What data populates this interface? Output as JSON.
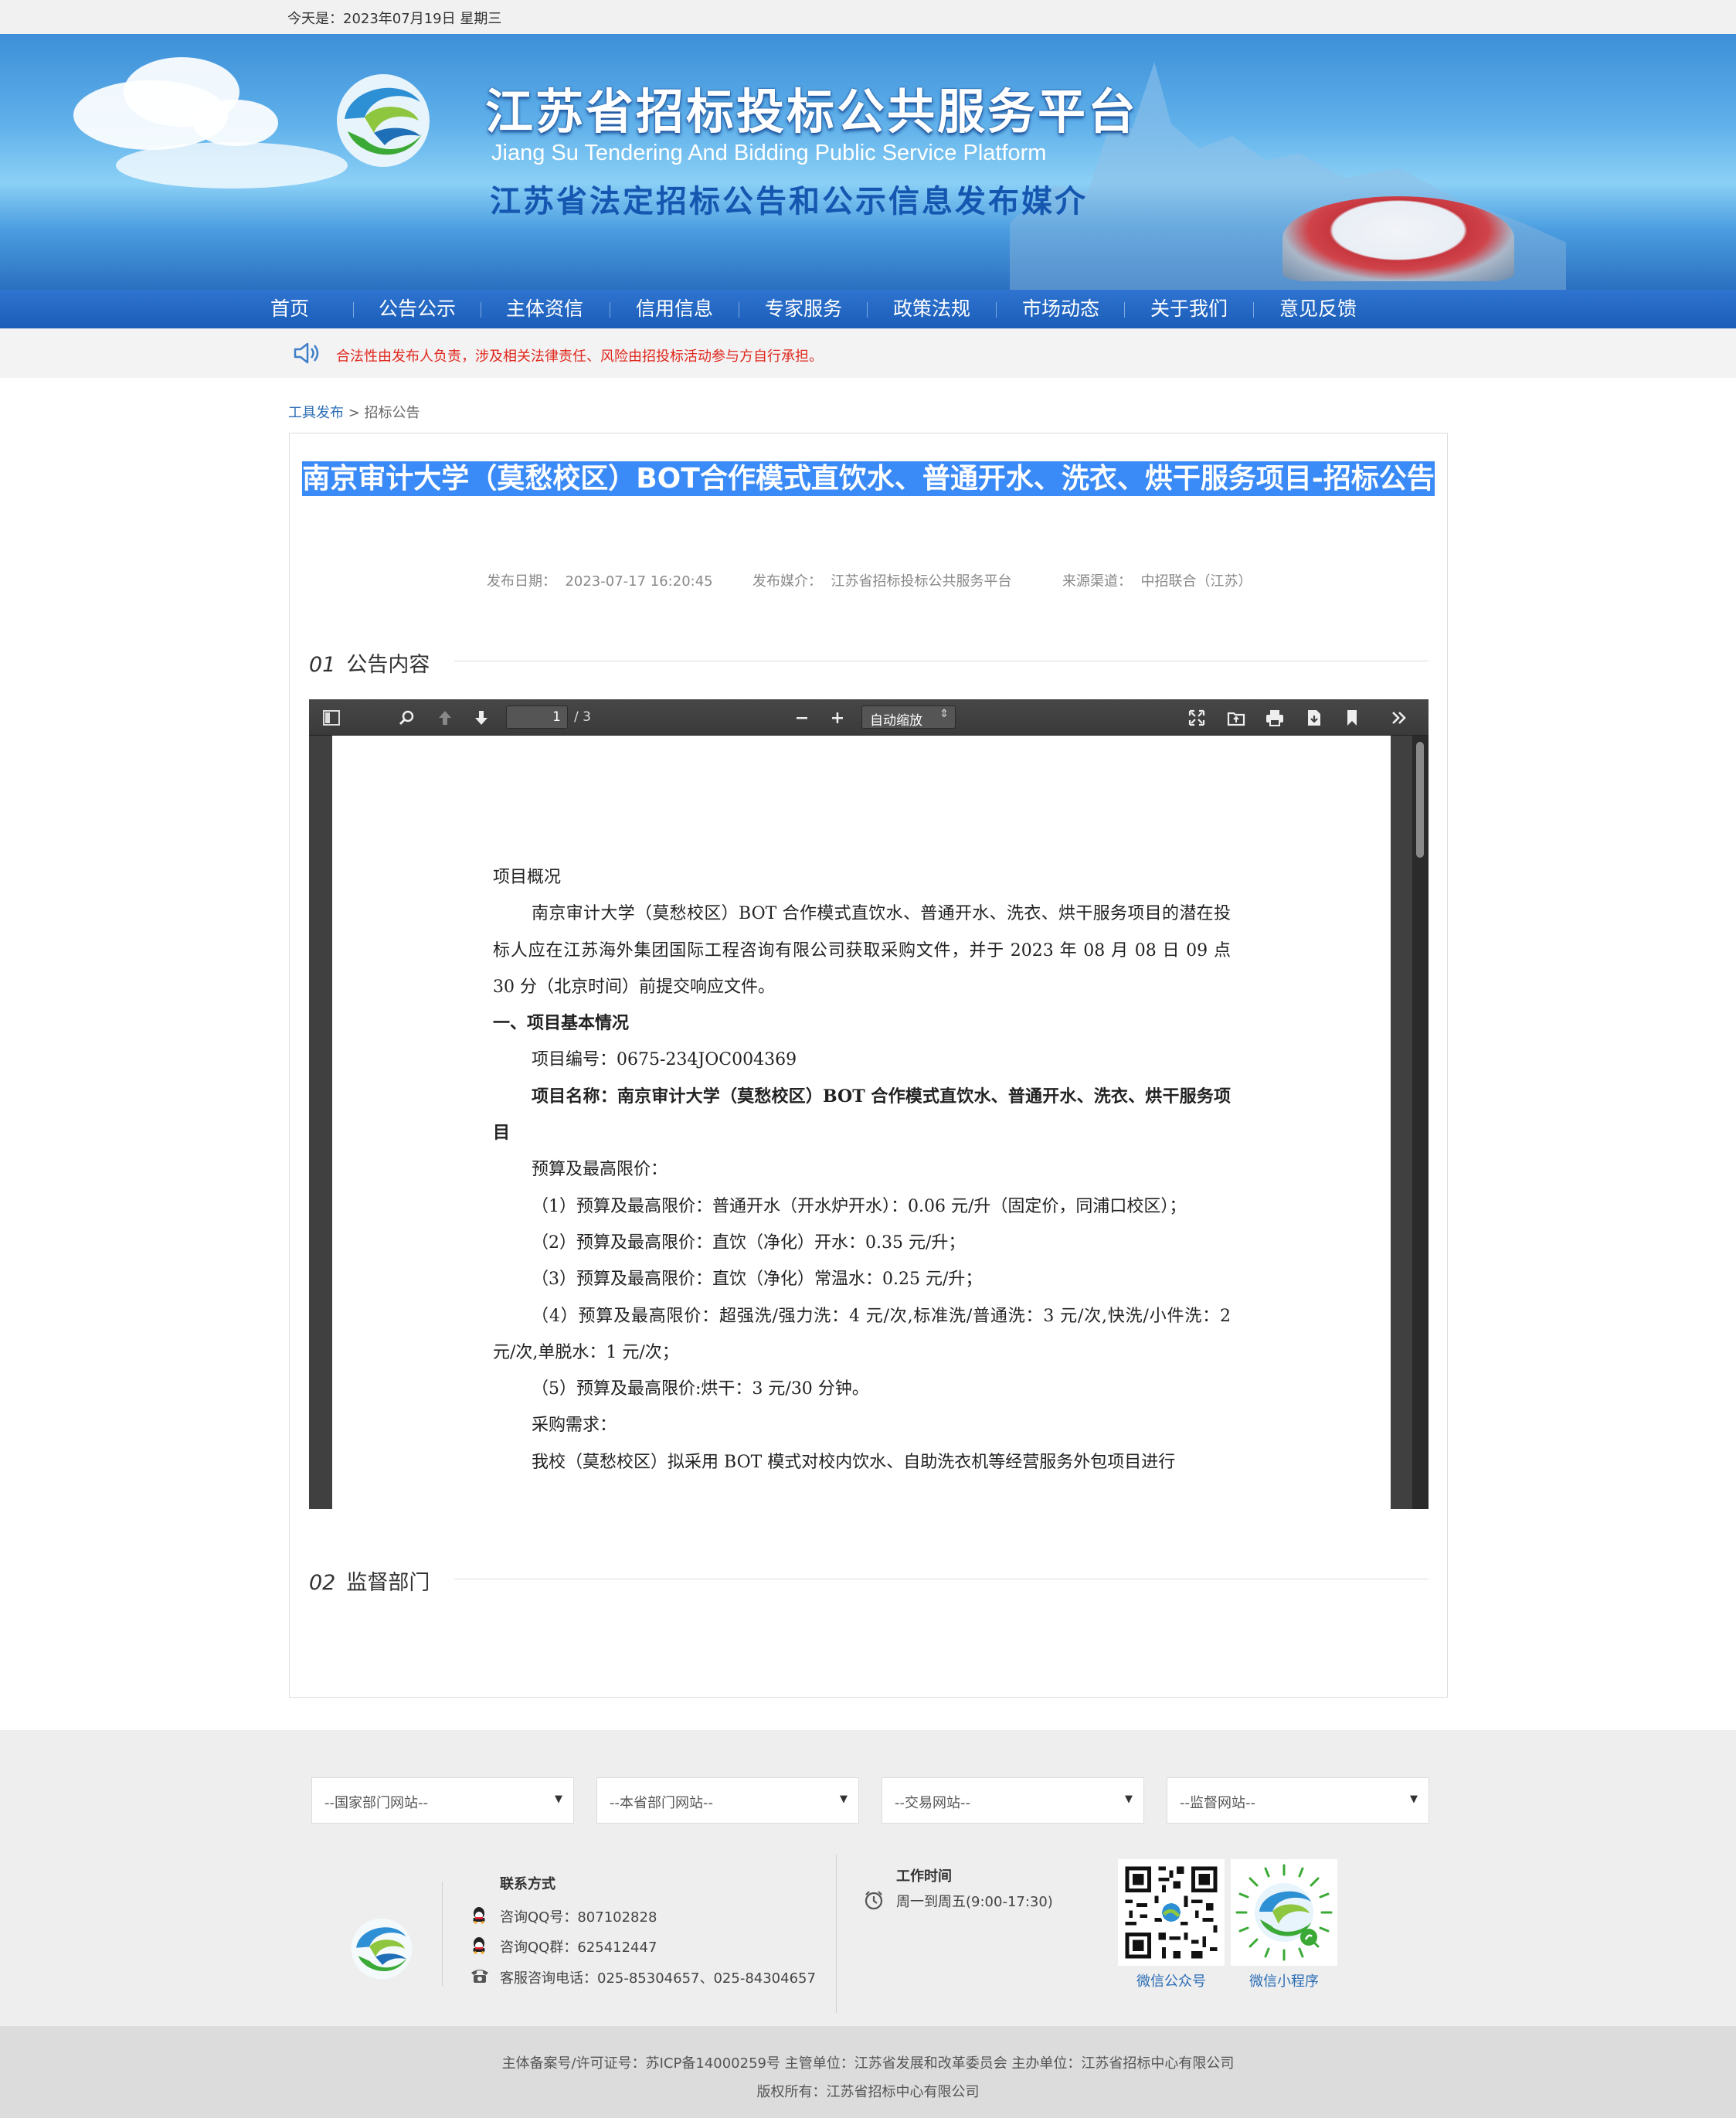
{
  "topbar": {
    "date_text": "今天是：2023年07月19日 星期三"
  },
  "header": {
    "title": "江苏省招标投标公共服务平台",
    "title_en": "Jiang Su Tendering And Bidding Public Service Platform",
    "subtitle": "江苏省法定招标公告和公示信息发布媒介"
  },
  "nav": {
    "items": [
      "首页",
      "公告公示",
      "主体资信",
      "信用信息",
      "专家服务",
      "政策法规",
      "市场动态",
      "关于我们",
      "意见反馈"
    ]
  },
  "notice": {
    "text": "合法性由发布人负责，涉及相关法律责任、风险由招投标活动参与方自行承担。"
  },
  "breadcrumb": {
    "home": "工具发布",
    "sep": " > ",
    "current": "招标公告"
  },
  "article": {
    "title": "南京审计大学（莫愁校区）BOT合作模式直饮水、普通开水、洗衣、烘干服务项目-招标公告",
    "publish_date_label": "发布日期：",
    "publish_date": "2023-07-17 16:20:45",
    "media_label": "发布媒介：",
    "media": "江苏省招标投标公共服务平台",
    "source_label": "来源渠道：",
    "source": "中招联合（江苏）"
  },
  "sections": [
    {
      "num": "01",
      "title": "公告内容"
    },
    {
      "num": "02",
      "title": "监督部门"
    }
  ],
  "pdf_viewer": {
    "page_number": "1",
    "page_count": "/ 3",
    "zoom": "自动缩放",
    "icons": [
      "sidebar-toggle-icon",
      "search-icon",
      "previous-page-icon",
      "next-page-icon",
      "zoom-out-icon",
      "zoom-in-icon",
      "presentation-mode-icon",
      "open-file-icon",
      "print-icon",
      "download-icon",
      "bookmark-icon",
      "tools-icon"
    ],
    "doc_lines": [
      {
        "text": "项目概况",
        "style": ""
      },
      {
        "text": "南京审计大学（莫愁校区）BOT 合作模式直饮水、普通开水、洗衣、烘干服务项目的潜在投标人应在江苏海外集团国际工程咨询有限公司获取采购文件，并于 2023 年 08 月 08 日 09 点 30 分（北京时间）前提交响应文件。",
        "style": "ind"
      },
      {
        "text": "一、项目基本情况",
        "style": "b"
      },
      {
        "text": "项目编号：0675-234JOC004369",
        "style": "ind"
      },
      {
        "text": "项目名称：南京审计大学（莫愁校区）BOT 合作模式直饮水、普通开水、洗衣、烘干服务项目",
        "style": "ind b"
      },
      {
        "text": "预算及最高限价：",
        "style": "ind"
      },
      {
        "text": "（1）预算及最高限价：普通开水（开水炉开水）：0.06 元/升（固定价，同浦口校区）；",
        "style": "ind"
      },
      {
        "text": "（2）预算及最高限价：直饮（净化）开水：0.35 元/升；",
        "style": "ind"
      },
      {
        "text": "（3）预算及最高限价：直饮（净化）常温水：0.25 元/升；",
        "style": "ind"
      },
      {
        "text": "（4）预算及最高限价：超强洗/强力洗：4 元/次,标准洗/普通洗：3 元/次,快洗/小件洗：2 元/次,单脱水：1 元/次；",
        "style": "ind"
      },
      {
        "text": "（5）预算及最高限价:烘干：3 元/30 分钟。",
        "style": "ind"
      },
      {
        "text": "采购需求：",
        "style": "ind"
      },
      {
        "text": "我校（莫愁校区）拟采用 BOT 模式对校内饮水、自助洗衣机等经营服务外包项目进行",
        "style": "ind"
      }
    ]
  },
  "footer": {
    "selects": [
      "--国家部门网站--",
      "--本省部门网站--",
      "--交易网站--",
      "--监督网站--"
    ],
    "contact_title": "联系方式",
    "qq_label": "咨询QQ号：807102828",
    "qq_group": "咨询QQ群：625412447",
    "phone": "客服咨询电话：025-85304657、025-84304657",
    "hours_title": "工作时间",
    "hours": "周一到周五(9:00-17:30)",
    "qr_wechat": "微信公众号",
    "qr_mini": "微信小程序",
    "record": "主体备案号/许可证号：苏ICP备14000259号 主管单位：江苏省发展和改革委员会 主办单位：江苏省招标中心有限公司",
    "copyright": "版权所有：江苏省招标中心有限公司"
  },
  "colors": {
    "nav": "#1f62c0",
    "notice_text": "#e0281e",
    "link": "#2b6db5",
    "selection": "#3a8af7"
  }
}
